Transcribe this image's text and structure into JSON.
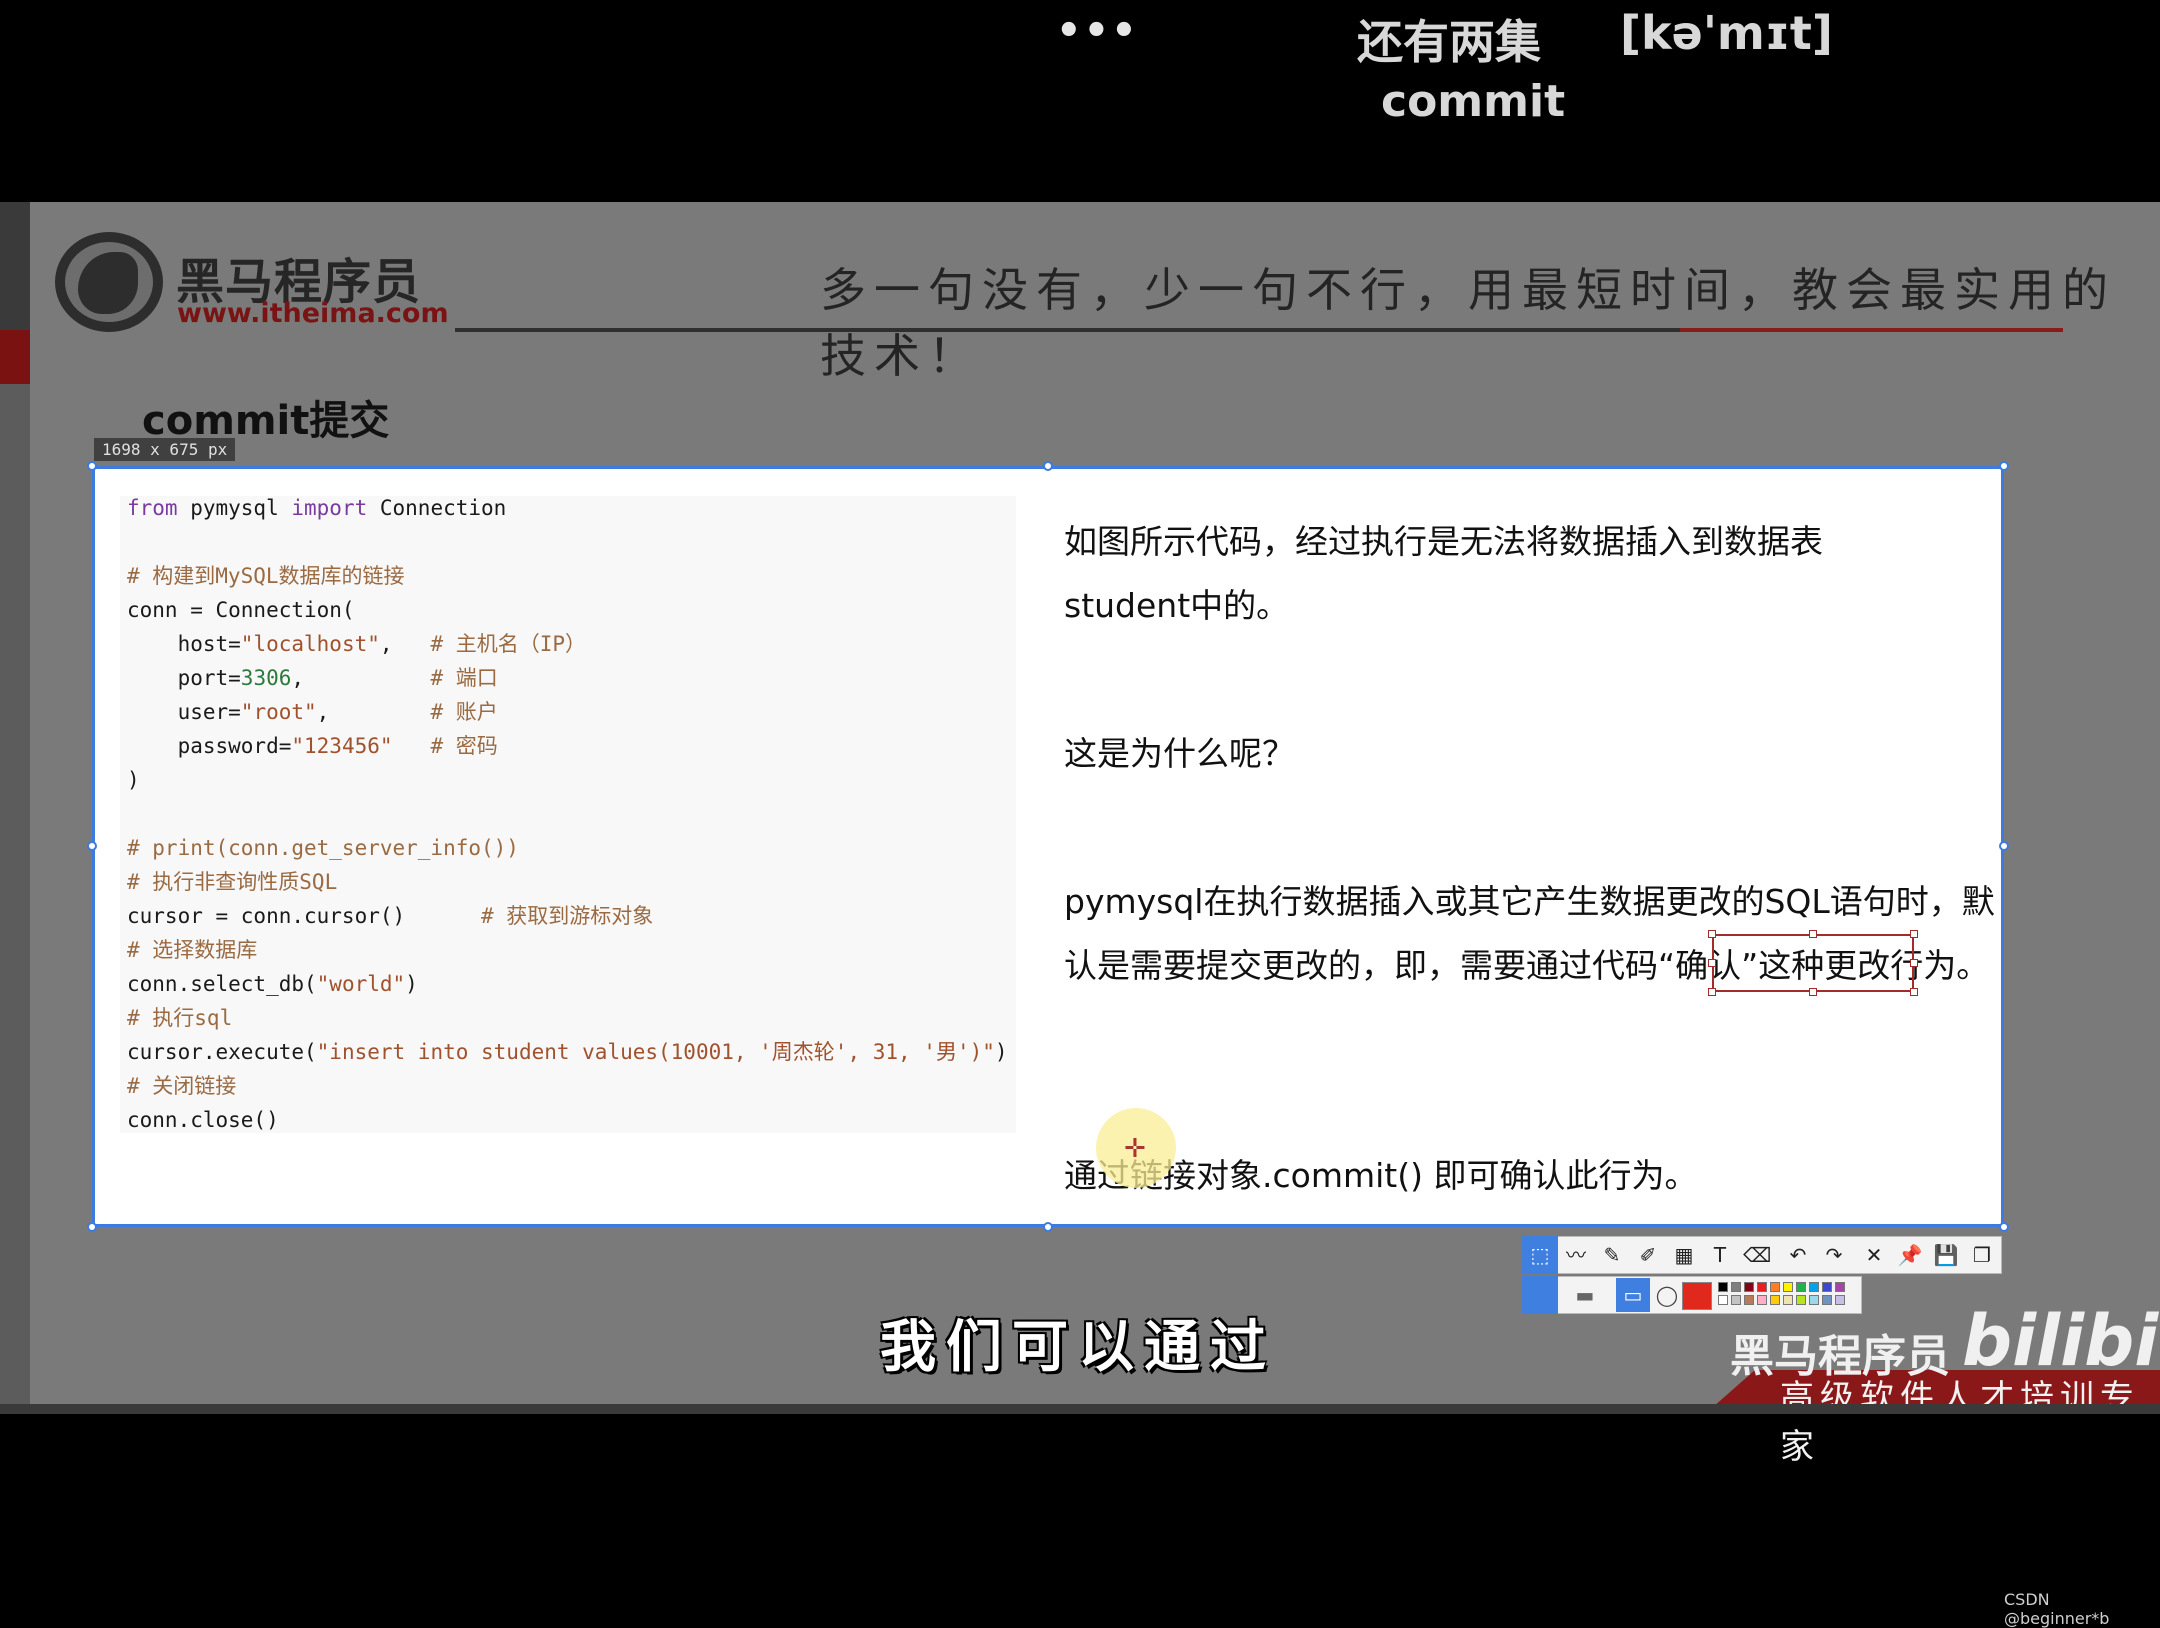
{
  "top": {
    "menu_dots": "•••",
    "vocab_word": "还有两集",
    "vocab_phonetic": "[kə'mɪt]",
    "vocab_english": "commit"
  },
  "slide": {
    "logo_cn": "黑马程序员",
    "logo_url": "www.itheima.com",
    "slogan": "多一句没有，少一句不行，用最短时间，教会最实用的技术！",
    "section_title": "commit提交",
    "size_label": "1698 x 675  px"
  },
  "code": {
    "lines": [
      "from pymysql import Connection",
      "",
      "# 构建到MySQL数据库的链接",
      "conn = Connection(",
      "    host=\"localhost\",   # 主机名（IP）",
      "    port=3306,          # 端口",
      "    user=\"root\",        # 账户",
      "    password=\"123456\"   # 密码",
      ")",
      "",
      "# print(conn.get_server_info())",
      "# 执行非查询性质SQL",
      "cursor = conn.cursor()      # 获取到游标对象",
      "# 选择数据库",
      "conn.select_db(\"world\")",
      "# 执行sql",
      "cursor.execute(\"insert into student values(10001, '周杰轮', 31, '男')\")",
      "# 关闭链接",
      "conn.close()"
    ]
  },
  "explain": {
    "p1": "如图所示代码，经过执行是无法将数据插入到数据表student中的。",
    "p2": "这是为什么呢？",
    "p3": "pymysql在执行数据插入或其它产生数据更改的SQL语句时，默认是需要提交更改的，即，需要通过代码“确认”这种更改行为。",
    "p4": "通过链接对象.commit() 即可确认此行为。"
  },
  "toolbar": {
    "tools": [
      "select-icon",
      "line-icon",
      "pencil-icon",
      "marker-icon",
      "mosaic-icon",
      "text-icon",
      "eraser-icon",
      "undo-icon",
      "redo-icon",
      "close-icon",
      "pin-icon",
      "save-icon",
      "copy-icon"
    ],
    "glyphs": [
      "⬚",
      "〰",
      "✎",
      "✐",
      "▦",
      "T",
      "⌫",
      "↶",
      "↷",
      "✕",
      "📌",
      "💾",
      "❐"
    ],
    "active_color": "#e0281c",
    "palette": [
      "#000000",
      "#7f7f7f",
      "#880015",
      "#ed1c24",
      "#ff7f27",
      "#fff200",
      "#22b14c",
      "#00a2e8",
      "#3f48cc",
      "#a349a4",
      "#ffffff",
      "#c3c3c3",
      "#b97a57",
      "#ffaec9",
      "#ffc90e",
      "#efe4b0",
      "#b5e61d",
      "#99d9ea",
      "#7092be",
      "#c8bfe7"
    ]
  },
  "video": {
    "subtitle": "我们可以通过",
    "brand": "黑马程序员",
    "bili": "bilibili",
    "brand_slogan": "高级软件人才培训专家",
    "watermark": "CSDN @beginner*b"
  }
}
